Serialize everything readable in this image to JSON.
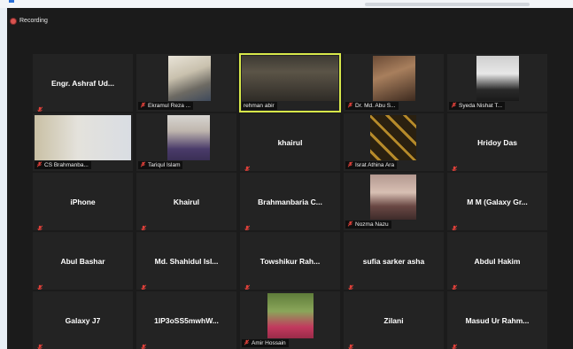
{
  "recording": {
    "label": "Recording"
  },
  "tiles": [
    {
      "name": "Engr. Ashraf Ud...",
      "video": false
    },
    {
      "name": "Ekramul Reza ...",
      "video": true
    },
    {
      "name": "rehman abir",
      "video": true,
      "active": true
    },
    {
      "name": "Dr. Md. Abu S...",
      "video": true
    },
    {
      "name": "Syeda Nishat T...",
      "video": true
    },
    {
      "name": "CS Brahmanba...",
      "video": true
    },
    {
      "name": "Tariqul Islam",
      "video": true
    },
    {
      "name": "khairul",
      "video": false
    },
    {
      "name": "Israt Athina Ara",
      "video": true
    },
    {
      "name": "Hridoy Das",
      "video": false
    },
    {
      "name": "iPhone",
      "video": false
    },
    {
      "name": "Khairul",
      "video": false
    },
    {
      "name": "Brahmanbaria C...",
      "video": false
    },
    {
      "name": "Nozma Nazu",
      "video": true
    },
    {
      "name": "M M (Galaxy Gr...",
      "video": false
    },
    {
      "name": "Abul Bashar",
      "video": false
    },
    {
      "name": "Md. Shahidul Isl...",
      "video": false
    },
    {
      "name": "Towshikur Rah...",
      "video": false
    },
    {
      "name": "sufia sarker asha",
      "video": false
    },
    {
      "name": "Abdul Hakim",
      "video": false
    },
    {
      "name": "Galaxy J7",
      "video": false
    },
    {
      "name": "1IP3oSS5mwhW...",
      "video": false
    },
    {
      "name": "Amir Hossain",
      "video": true
    },
    {
      "name": "Zilani",
      "video": false
    },
    {
      "name": "Masud Ur Rahm...",
      "video": false
    }
  ],
  "colors": {
    "accent_active": "#d8e84a",
    "muted_mic": "#e0413a",
    "recording_dot": "#d9534f"
  }
}
